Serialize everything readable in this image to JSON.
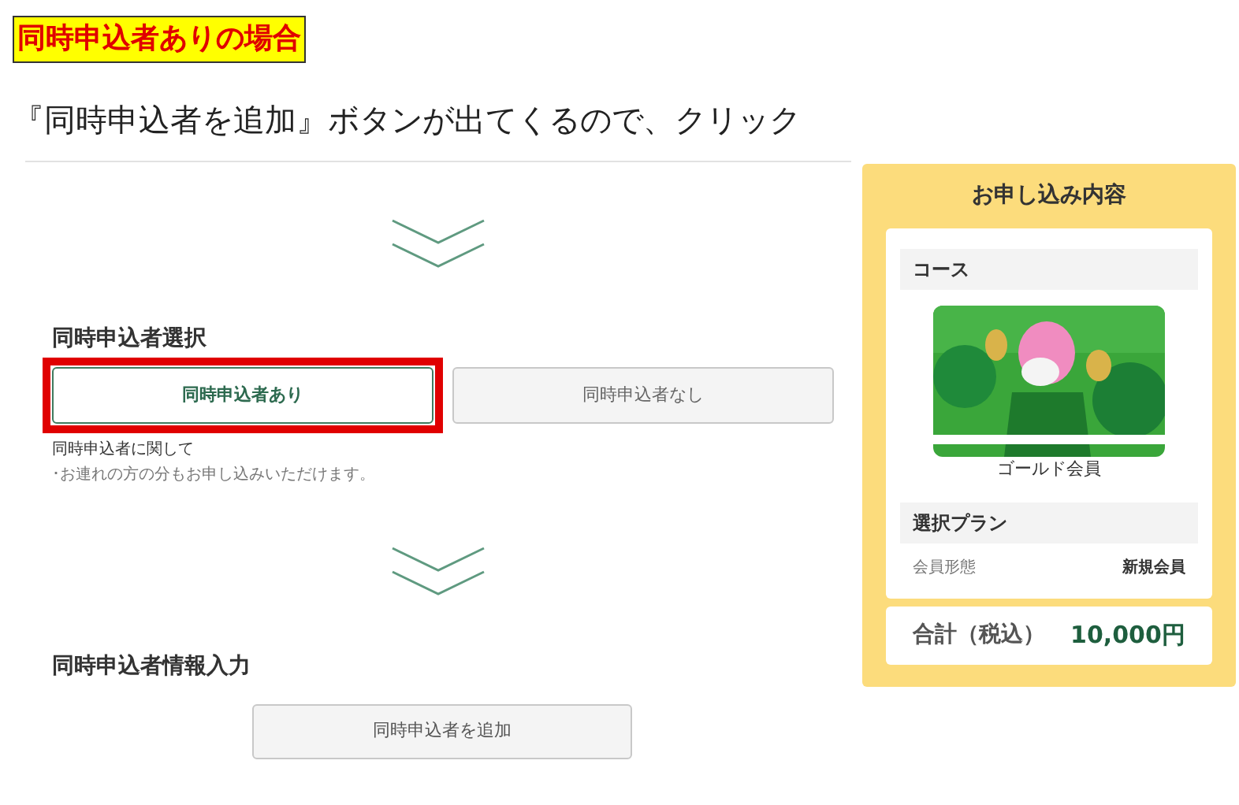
{
  "annotation": {
    "label": "同時申込者ありの場合",
    "instruction": "『同時申込者を追加』ボタンが出てくるので、クリック"
  },
  "companion_select": {
    "heading": "同時申込者選択",
    "choices": [
      {
        "label": "同時申込者あり",
        "selected": true,
        "highlighted": true
      },
      {
        "label": "同時申込者なし",
        "selected": false,
        "highlighted": false
      }
    ],
    "note_title": "同時申込者に関して",
    "note": "･お連れの方の分もお申し込みいただけます。"
  },
  "companion_info": {
    "heading": "同時申込者情報入力",
    "add_button": "同時申込者を追加"
  },
  "summary": {
    "title": "お申し込み内容",
    "course_header": "コース",
    "course_name": "ゴールド会員",
    "plan_header": "選択プラン",
    "plan_rows": [
      {
        "label": "会員形態",
        "value": "新規会員"
      }
    ],
    "total_label": "合計（税込）",
    "total_value": "10,000円"
  }
}
